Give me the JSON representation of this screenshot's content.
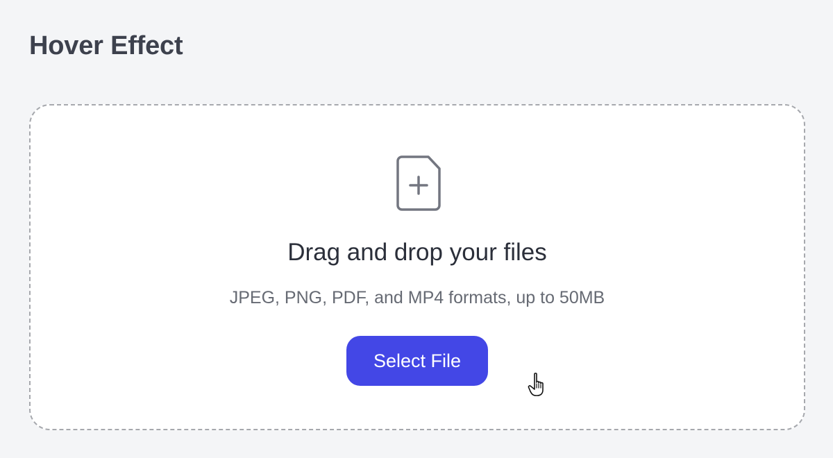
{
  "page": {
    "title": "Hover Effect"
  },
  "dropzone": {
    "icon": "file-plus-icon",
    "headline": "Drag and drop your files",
    "subtext": "JPEG, PNG, PDF, and MP4 formats, up to 50MB",
    "button_label": "Select File"
  },
  "cursor": {
    "icon": "pointer-hand-icon"
  },
  "colors": {
    "background": "#f4f5f7",
    "accent": "#4347e6",
    "title": "#3d414d",
    "border": "#a6a8ad"
  }
}
